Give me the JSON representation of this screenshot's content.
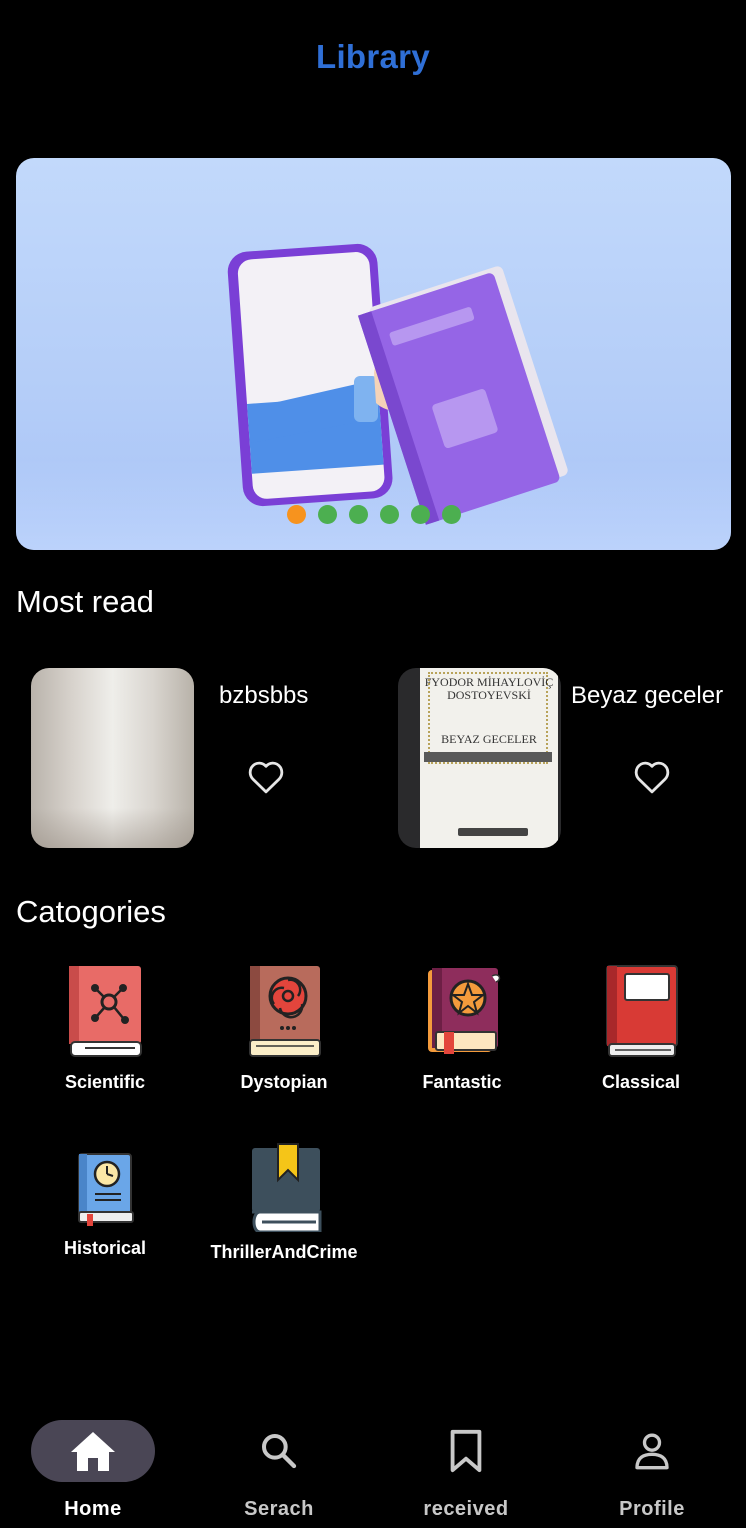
{
  "header": {
    "title": "Library"
  },
  "carousel": {
    "dot_count": 6,
    "active_index": 0
  },
  "most_read": {
    "title": "Most read",
    "items": [
      {
        "name": "bzbsbbs"
      },
      {
        "name": "Beyaz geceler",
        "cover_author": "FYODOR MİHAYLOVİÇ DOSTOYEVSKİ",
        "cover_title": "BEYAZ GECELER"
      }
    ]
  },
  "categories": {
    "title": "Catogories",
    "items": [
      {
        "label": "Scientific",
        "icon": "scientific-book-icon"
      },
      {
        "label": "Dystopian",
        "icon": "dystopian-book-icon"
      },
      {
        "label": "Fantastic",
        "icon": "fantastic-book-icon"
      },
      {
        "label": "Classical",
        "icon": "classical-book-icon"
      },
      {
        "label": "Historical",
        "icon": "historical-book-icon"
      },
      {
        "label": "ThrillerAndCrime",
        "icon": "thriller-book-icon"
      }
    ]
  },
  "bottom_nav": {
    "items": [
      {
        "label": "Home",
        "icon": "home-icon",
        "active": true
      },
      {
        "label": "Serach",
        "icon": "search-icon",
        "active": false
      },
      {
        "label": "received",
        "icon": "bookmark-icon",
        "active": false
      },
      {
        "label": "Profile",
        "icon": "person-icon",
        "active": false
      }
    ]
  },
  "colors": {
    "title": "#2f6fd6",
    "dot_active": "#f7931e",
    "dot": "#4caf50",
    "nav_pill": "#4a4655"
  }
}
